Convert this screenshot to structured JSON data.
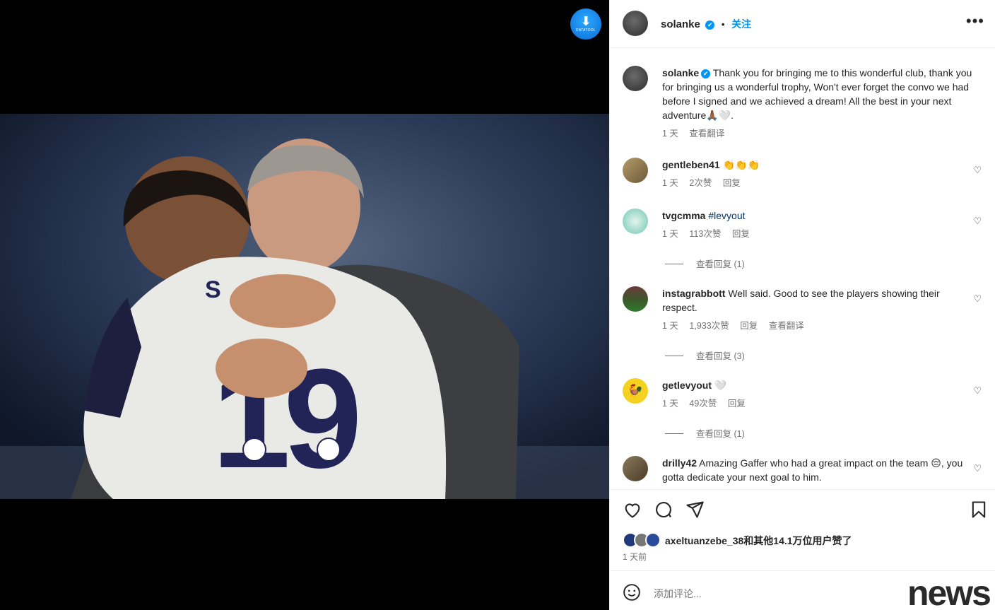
{
  "media": {
    "download_badge": "DATATOOL"
  },
  "header": {
    "username": "solanke",
    "verified_mark": "✔",
    "separator": "•",
    "follow_label": "关注",
    "more_label": "•••"
  },
  "caption": {
    "username": "solanke",
    "text": "Thank you for bringing me to this wonderful club, thank you for bringing us a wonderful trophy, Won't ever forget the convo we had before I signed and we achieved a dream! All the best in your next adventure🙏🏾🤍.",
    "time": "1 天",
    "translate": "查看翻译"
  },
  "comments": [
    {
      "username": "gentleben41",
      "text": "👏👏👏",
      "time": "1 天",
      "likes": "2次赞",
      "reply": "回复"
    },
    {
      "username": "tvgcmma",
      "text": "#levyout",
      "time": "1 天",
      "likes": "113次赞",
      "reply": "回复",
      "replies": "查看回复 (1)"
    },
    {
      "username": "instagrabbott",
      "text": "Well said. Good to see the players showing their respect.",
      "time": "1 天",
      "likes": "1,933次赞",
      "reply": "回复",
      "translate": "查看翻译",
      "replies": "查看回复 (3)"
    },
    {
      "username": "getlevyout",
      "text": "🤍",
      "time": "1 天",
      "likes": "49次赞",
      "reply": "回复",
      "replies": "查看回复 (1)"
    },
    {
      "username": "drilly42",
      "text": "Amazing Gaffer who had a great impact on the team 😔, you gotta dedicate your next goal to him."
    }
  ],
  "actions": {
    "like_icon": "heart-icon",
    "comment_icon": "comment-icon",
    "share_icon": "paper-plane-icon",
    "save_icon": "bookmark-icon",
    "liked_by": "axeltuanzebe_38和其他14.1万位用户赞了",
    "time": "1 天前"
  },
  "add_comment": {
    "placeholder": "添加评论...",
    "emoji_icon": "smiley-icon"
  },
  "watermark": "news",
  "colors": {
    "accent": "#0095f6",
    "text": "#262626",
    "secondary": "#737373",
    "hashtag": "#00376b",
    "border": "#efefef"
  }
}
